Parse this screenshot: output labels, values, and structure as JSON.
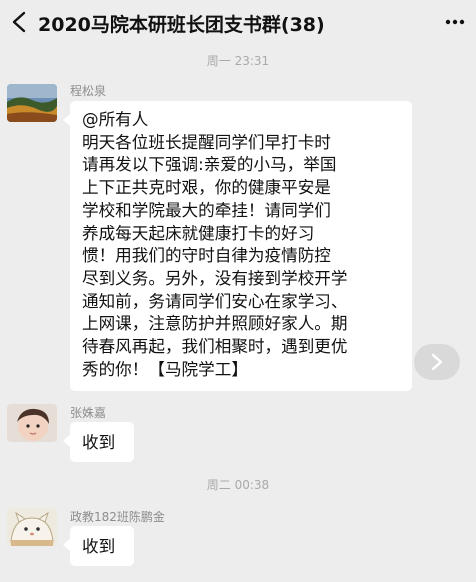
{
  "header": {
    "title": "2020马院本研班长团支书群(38)",
    "back_icon": "chevron-left-icon",
    "more_icon": "more-dots-icon"
  },
  "messages": [
    {
      "timestamp": "周一 23:31",
      "sender": "程松泉",
      "avatar_icon": "landscape-avatar",
      "text": "@所有人\n明天各位班长提醒同学们早打卡时\n请再发以下强调:亲爱的小马，举国\n上下正共克时艰，你的健康平安是\n学校和学院最大的牵挂！请同学们\n养成每天起床就健康打卡的好习\n惯！用我们的守时自律为疫情防控\n尽到义务。另外，没有接到学校开学\n通知前，务请同学们安心在家学习、\n上网课，注意防护并照顾好家人。期\n待春风再起，我们相聚时，遇到更优\n秀的你！【马院学工】"
    },
    {
      "sender": "张姝嘉",
      "avatar_icon": "child-photo-avatar",
      "text": "收到"
    },
    {
      "timestamp": "周二 00:38",
      "sender": "政教182班陈鹏金",
      "avatar_icon": "cartoon-cat-avatar",
      "text": "收到"
    }
  ],
  "forward_icon": "chevron-right-icon"
}
